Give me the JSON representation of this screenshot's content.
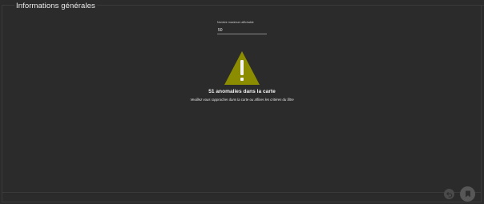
{
  "panel": {
    "title": "Informations générales"
  },
  "field": {
    "label": "Nombre maximum affichable",
    "value": "50"
  },
  "message": {
    "title": "51 anomalies dans la carte",
    "subtitle": "Veuillez vous rapprocher dans la carte ou affiner les critères du filtre"
  },
  "icons": {
    "warning": "warning-triangle-icon",
    "undo": "undo-icon",
    "save": "bookmark-icon"
  },
  "colors": {
    "background": "#2b2b2b",
    "warning": "#8c8c00",
    "text": "#f2f2f2"
  }
}
